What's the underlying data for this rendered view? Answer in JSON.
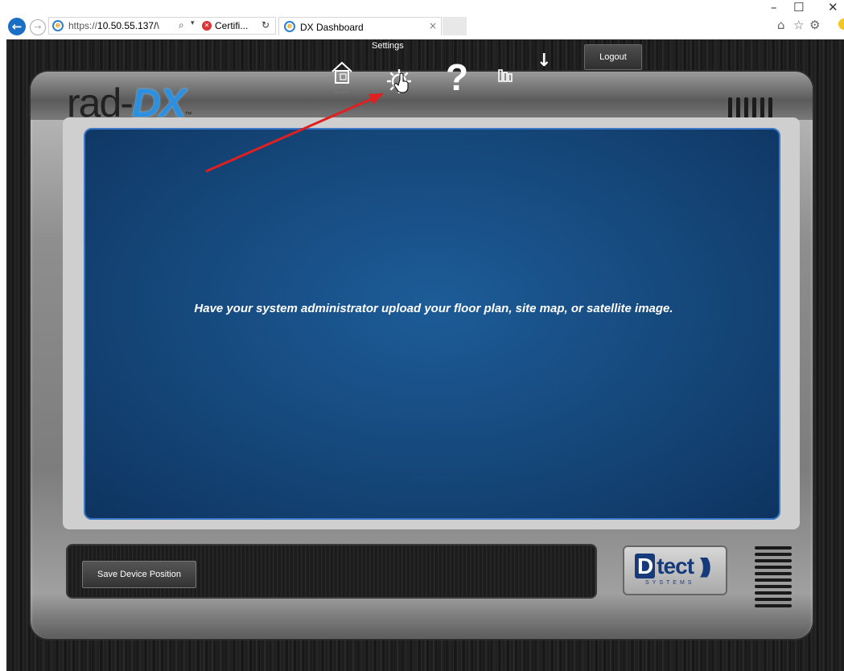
{
  "browser": {
    "address_scheme": "https://",
    "address_host": "10.50.55.137/",
    "address_tail": "\\",
    "search_glyph": "⌕",
    "dropdown_glyph": "▾",
    "cert_label": "Certifi...",
    "refresh_glyph": "↻",
    "tab_title": "DX Dashboard",
    "tab_close": "×",
    "minimize": "–",
    "maximize": "☐",
    "close": "✕",
    "home_glyph": "⌂",
    "favorites_glyph": "☆",
    "tools_glyph": "⚙"
  },
  "app": {
    "logo_prefix": "rad-",
    "logo_dx": "DX",
    "logo_tm": "™",
    "toolbar_hover_label": "Settings",
    "help_glyph": "?",
    "download_glyph": "↓",
    "logout_label": "Logout",
    "collapse_glyph": "⌄",
    "message": "Have your system administrator upload your floor plan, site map, or satellite image.",
    "save_label": "Save Device Position",
    "brand_d": "D",
    "brand_word": "tect",
    "brand_waves": ")))",
    "brand_sub": "SYSTEMS"
  },
  "colors": {
    "accent_blue": "#2d8fe0",
    "screen_blue": "#15477a",
    "arrow_red": "#e02020",
    "brand_navy": "#163a7a"
  },
  "icons": [
    "back-arrow-icon",
    "forward-arrow-icon",
    "ie-icon",
    "certificate-error-icon",
    "home-icon",
    "settings-gear-icon",
    "help-icon",
    "stats-icon",
    "download-icon",
    "chevron-down-icon"
  ]
}
